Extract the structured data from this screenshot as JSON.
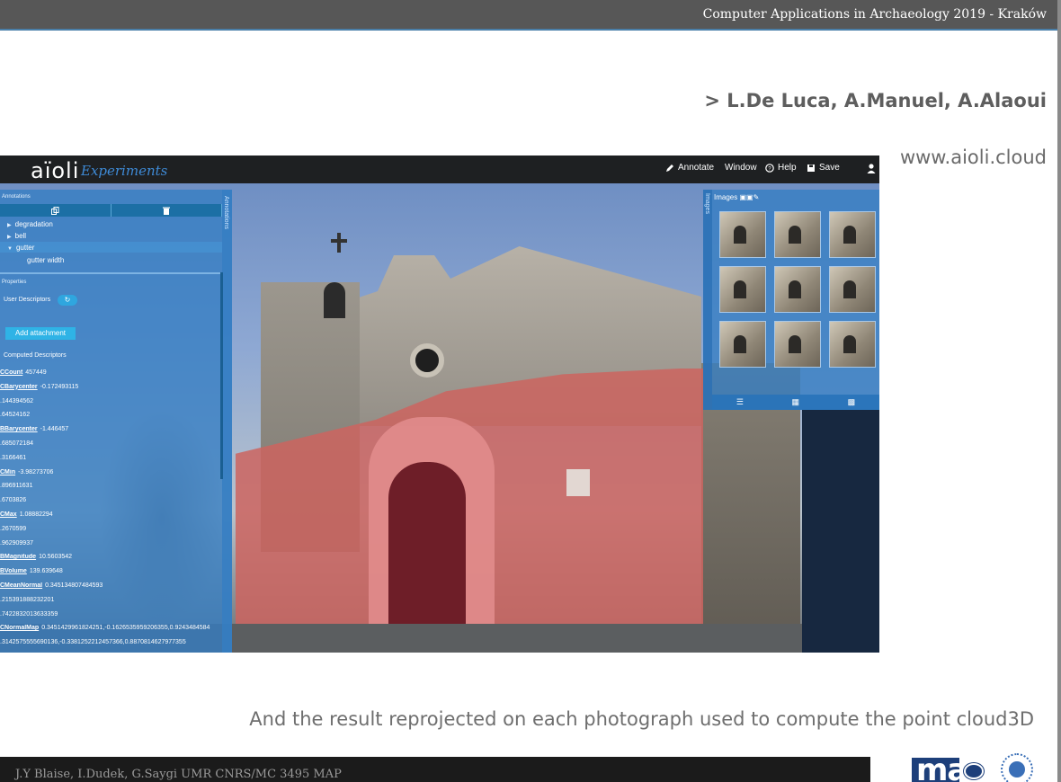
{
  "slide": {
    "conference": "Computer Applications in Archaeology  2019 - Kraków",
    "authors": "> L.De Luca, A.Manuel, A.Alaoui",
    "website": "www.aioli.cloud",
    "caption": "And the result reprojected on each photograph used to compute the point cloud3D",
    "credits": "J.Y Blaise, I.Dudek, G.Saygi UMR CNRS/MC 3495 MAP",
    "logo_map": "map"
  },
  "app": {
    "brand": "aïoli",
    "brand_sub": "Experiments",
    "nav": {
      "annotate": "Annotate",
      "window": "Window",
      "help": "Help",
      "save": "Save"
    },
    "annotations": {
      "title": "Annotations",
      "vtab_label": "Annotations",
      "tree": [
        "degradation",
        "bell",
        "gutter",
        "gutter width"
      ]
    },
    "properties": {
      "title": "Properties",
      "user_descriptors": "User Descriptors",
      "add_attachment": "Add attachment",
      "computed_descriptors": "Computed Descriptors",
      "rows": [
        {
          "k": "CCount",
          "v": "457449"
        },
        {
          "k": "CBarycenter",
          "v": "-0.172493115"
        },
        {
          "k": "",
          "v": ".144394562"
        },
        {
          "k": "",
          "v": ".64524162"
        },
        {
          "k": "BBarycenter",
          "v": "-1.446457"
        },
        {
          "k": "",
          "v": ".685072184"
        },
        {
          "k": "",
          "v": ".3166461"
        },
        {
          "k": "CMin",
          "v": "-3.98273706"
        },
        {
          "k": "",
          "v": ".896911631"
        },
        {
          "k": "",
          "v": ".6703826"
        },
        {
          "k": "CMax",
          "v": "1.08882294"
        },
        {
          "k": "",
          "v": ".2670599"
        },
        {
          "k": "",
          "v": ".962909937"
        },
        {
          "k": "BMagnitude",
          "v": "10.5603542"
        },
        {
          "k": "BVolume",
          "v": "139.639648"
        },
        {
          "k": "CMeanNormal",
          "v": "0.345134807484593"
        },
        {
          "k": "",
          "v": ".215391888232201"
        },
        {
          "k": "",
          "v": ".7422832013633359"
        },
        {
          "k": "CNormalMap",
          "v": "0.3451429961824251,-0.1626535959206355,0.9243484584"
        },
        {
          "k": "",
          "v": ".3142575555690136,-0.3381252212457366,0.8870814627977355"
        }
      ]
    },
    "images": {
      "title": "Images",
      "vtab_label": "Images"
    }
  }
}
